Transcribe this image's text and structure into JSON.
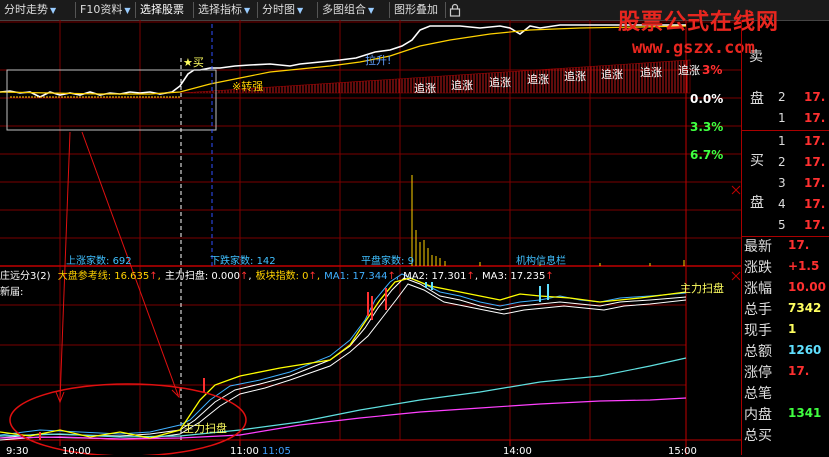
{
  "toolbar": {
    "tabs": [
      {
        "label": "分时走势",
        "dropdown": true
      },
      {
        "label": "F10资料",
        "dropdown": true
      },
      {
        "label": "选择股票",
        "dropdown": false
      },
      {
        "label": "选择指标",
        "dropdown": true
      },
      {
        "label": "分时图",
        "dropdown": true
      },
      {
        "label": "多图组合",
        "dropdown": true
      },
      {
        "label": "图形叠加",
        "dropdown": false
      }
    ]
  },
  "watermark": {
    "name": "股票公式在线网",
    "url": "www.gszx.com"
  },
  "price_pane": {
    "pct_labels": [
      "3%",
      "0.0%",
      "3.3%",
      "6.7%"
    ],
    "annotations": {
      "buy": "★买",
      "strong": "※转强",
      "rise": "拉升!",
      "chase": "追涨"
    },
    "market": {
      "up_label": "上涨家数:",
      "up_value": "692",
      "down_label": "下跌家数:",
      "down_value": "142",
      "flat_label": "平盘家数:",
      "flat_value": "9",
      "info_label": "机构信息栏"
    }
  },
  "indicator_pane": {
    "name": "庄远分3(2)",
    "items": [
      {
        "label": "大盘参考线:",
        "value": "16.635",
        "color": "#ffd200"
      },
      {
        "label": "主力扫盘:",
        "value": "0.000",
        "color": "#ffffff"
      },
      {
        "label": "板块指数:",
        "value": "0",
        "color": "#ffd200"
      },
      {
        "label": "MA1:",
        "value": "17.344",
        "color": "#40b0ff"
      },
      {
        "label": "MA2:",
        "value": "17.301",
        "color": "#ffffff"
      },
      {
        "label": "MA3:",
        "value": "17.235",
        "color": "#ffffff"
      }
    ],
    "refresh": "新届:",
    "sweep_label": "主力扫盘"
  },
  "time_axis": [
    "9:30",
    "10:00",
    "11:00",
    "11:05",
    "14:00",
    "15:00"
  ],
  "right_panel": {
    "sell_heading": [
      "卖",
      "盘"
    ],
    "sell_nums": [
      "2",
      "1"
    ],
    "sell_prices": [
      "17.",
      "17."
    ],
    "buy_heading": [
      "买",
      "盘"
    ],
    "buy_nums": [
      "1",
      "2",
      "3",
      "4",
      "5"
    ],
    "buy_prices": [
      "17.",
      "17.",
      "17.",
      "17.",
      "17."
    ],
    "stats": [
      {
        "label": "最新",
        "value": "17.",
        "color": "#ff3030"
      },
      {
        "label": "涨跌",
        "value": "+1.5",
        "color": "#ff3030"
      },
      {
        "label": "涨幅",
        "value": "10.00",
        "color": "#ff3030"
      },
      {
        "label": "总手",
        "value": "7342",
        "color": "#ffff60"
      },
      {
        "label": "现手",
        "value": "1",
        "color": "#ffff60"
      },
      {
        "label": "总额",
        "value": "1260",
        "color": "#60e0ff"
      },
      {
        "label": "涨停",
        "value": "17.",
        "color": "#ff3030"
      },
      {
        "label": "总笔",
        "value": "",
        "color": "#ffff60"
      },
      {
        "label": "内盘",
        "value": "1341",
        "color": "#40ff40"
      },
      {
        "label": "总买",
        "value": "",
        "color": "#ffffff"
      }
    ]
  }
}
